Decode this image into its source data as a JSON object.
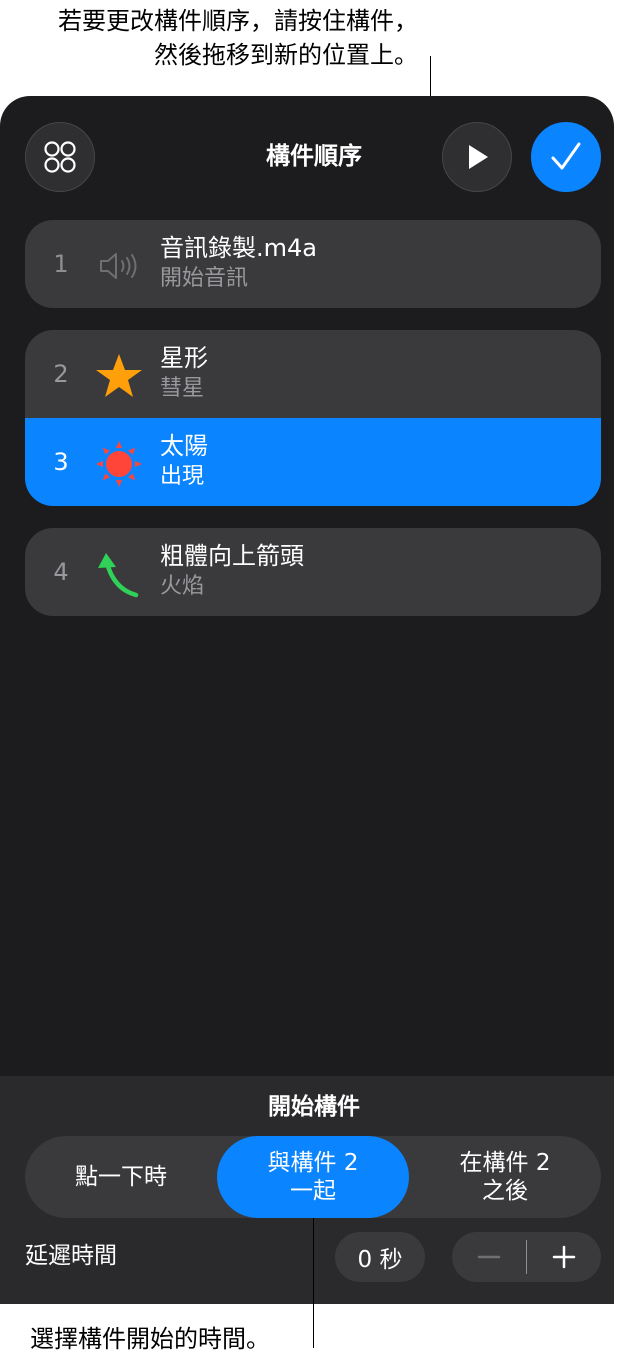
{
  "callouts": {
    "top_line1": "若要更改構件順序，請按住構件，",
    "top_line2": "然後拖移到新的位置上。",
    "bottom": "選擇構件開始的時間。"
  },
  "header": {
    "title": "構件順序",
    "order_icon": "four-circles-icon",
    "play_icon": "play-icon",
    "done_icon": "checkmark-icon"
  },
  "builds": [
    {
      "number": "1",
      "title": "音訊錄製.m4a",
      "subtitle": "開始音訊",
      "icon": "speaker-icon"
    },
    {
      "number": "2",
      "title": "星形",
      "subtitle": "彗星",
      "icon": "star-icon"
    },
    {
      "number": "3",
      "title": "太陽",
      "subtitle": "出現",
      "icon": "sun-icon"
    },
    {
      "number": "4",
      "title": "粗體向上箭頭",
      "subtitle": "火焰",
      "icon": "curved-arrow-icon"
    }
  ],
  "start_build": {
    "title": "開始構件",
    "options": [
      {
        "line1": "點一下時",
        "line2": ""
      },
      {
        "line1": "與構件 2",
        "line2": "一起"
      },
      {
        "line1": "在構件 2",
        "line2": "之後"
      }
    ],
    "selected_index": 1
  },
  "delay": {
    "label": "延遲時間",
    "value": "0 秒",
    "minus_icon": "minus-icon",
    "plus_icon": "plus-icon"
  },
  "colors": {
    "accent": "#0a84ff",
    "panel": "#1c1c1e",
    "row": "#3a3a3c",
    "star": "#ff9f0a",
    "sun": "#ff453a",
    "arrow": "#30d158"
  }
}
